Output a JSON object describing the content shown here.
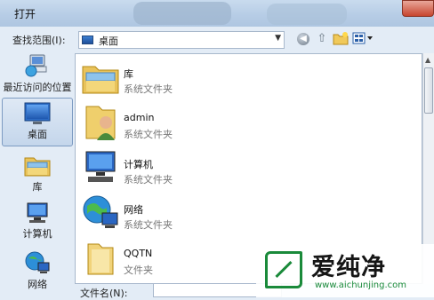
{
  "window": {
    "title": "打开"
  },
  "toolbar": {
    "lookin_label": "查找范围(I):",
    "location_value": "桌面",
    "back_icon": "back-icon",
    "up_icon": "up-folder-icon",
    "newfolder_icon": "new-folder-icon",
    "view_icon": "view-menu-icon"
  },
  "places": [
    {
      "label": "最近访问的位置",
      "icon": "recent-places-icon"
    },
    {
      "label": "桌面",
      "icon": "desktop-icon",
      "selected": true
    },
    {
      "label": "库",
      "icon": "libraries-icon"
    },
    {
      "label": "计算机",
      "icon": "computer-icon"
    },
    {
      "label": "网络",
      "icon": "network-icon"
    }
  ],
  "files": [
    {
      "name": "库",
      "type": "系统文件夹",
      "icon": "libraries-icon"
    },
    {
      "name": "admin",
      "type": "系统文件夹",
      "icon": "user-folder-icon"
    },
    {
      "name": "计算机",
      "type": "系统文件夹",
      "icon": "computer-icon"
    },
    {
      "name": "网络",
      "type": "系统文件夹",
      "icon": "network-icon"
    },
    {
      "name": "QQTN",
      "type": "文件夹",
      "icon": "folder-icon"
    }
  ],
  "footer": {
    "filename_label": "文件名(N):",
    "filename_value": ""
  },
  "watermark": {
    "brand": "爱纯净",
    "url": "www.aichunjing.com"
  }
}
